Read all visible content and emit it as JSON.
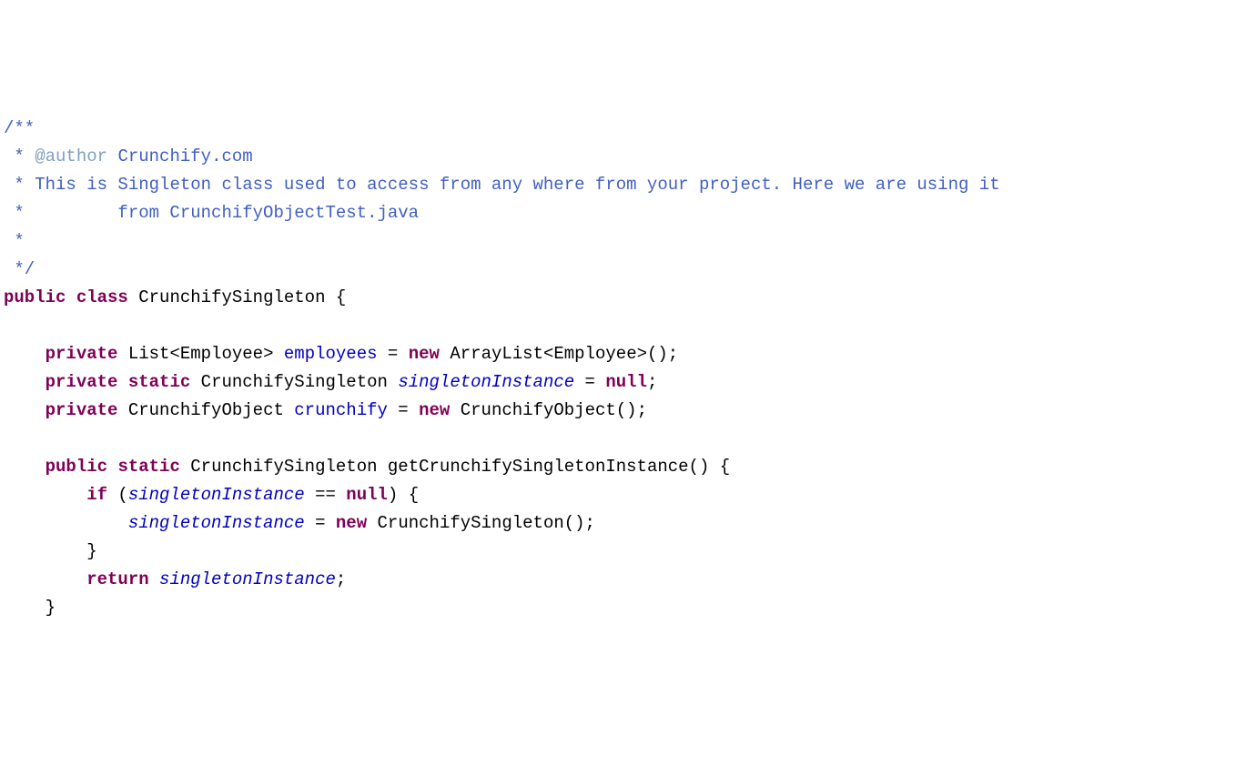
{
  "code": {
    "l1_open": "/**",
    "l2_star": " * ",
    "l2_tag": "@author",
    "l2_text": " Crunchify.com",
    "l3_star": " * ",
    "l3_text": "This is Singleton class used to access from any where from your project. Here we are using it",
    "l4_star": " *         ",
    "l4_text": "from CrunchifyObjectTest.java",
    "l5_star": " * ",
    "l6_close": " */",
    "l7_kw_public": "public",
    "l7_kw_class": "class",
    "l7_classname": "CrunchifySingleton",
    "l7_brace": "{",
    "l9_kw_private": "private",
    "l9_type": "List<Employee>",
    "l9_field": "employees",
    "l9_eq": " = ",
    "l9_kw_new": "new",
    "l9_ctor": "ArrayList<Employee>();",
    "l10_kw_private": "private",
    "l10_kw_static": "static",
    "l10_type": "CrunchifySingleton",
    "l10_field": "singletonInstance",
    "l10_eq": " = ",
    "l10_kw_null": "null",
    "l10_semi": ";",
    "l11_kw_private": "private",
    "l11_type": "CrunchifyObject",
    "l11_field": "crunchify",
    "l11_eq": " = ",
    "l11_kw_new": "new",
    "l11_ctor": "CrunchifyObject();",
    "l13_kw_public": "public",
    "l13_kw_static": "static",
    "l13_type": "CrunchifySingleton",
    "l13_method": "getCrunchifySingletonInstance()",
    "l13_brace": "{",
    "l14_kw_if": "if",
    "l14_open": " (",
    "l14_field": "singletonInstance",
    "l14_eq": " == ",
    "l14_kw_null": "null",
    "l14_close": ") {",
    "l15_field": "singletonInstance",
    "l15_eq": " = ",
    "l15_kw_new": "new",
    "l15_ctor": "CrunchifySingleton();",
    "l16_brace": "}",
    "l17_kw_return": "return",
    "l17_field": "singletonInstance",
    "l17_semi": ";",
    "l18_brace": "}"
  }
}
